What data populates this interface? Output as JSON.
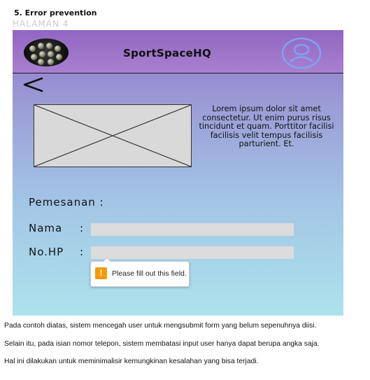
{
  "doc": {
    "section_heading": "5. Error prevention",
    "page_label": "HALAMAN 4",
    "paragraphs": [
      "Pada contoh diatas, sistem mencegah user untuk mengsubmit form yang belum sepenuhnya diisi.",
      "Selain itu, pada isian nomor telepon, sistem membatasi input user hanya dapat berupa angka saja.",
      "Hal ini dilakukan untuk meminimalisir kemungkinan kesalahan yang bisa terjadi."
    ]
  },
  "app": {
    "title": "SportSpaceHQ",
    "logo_icon": "sports-balls-logo",
    "profile_icon": "user-profile-icon",
    "back_icon": "back-arrow-icon",
    "description": "Lorem ipsum dolor sit amet consectetur. Ut enim purus risus tincidunt et quam. Porttitor facilisi facilisis velit tempus facilisis parturient. Et."
  },
  "form": {
    "section_label": "Pemesanan :",
    "name_label": "Nama",
    "name_value": "",
    "phone_label": "No.HP",
    "phone_value": "",
    "colon": ":",
    "validation_message": "Please fill out this field.",
    "warning_glyph": "!"
  },
  "colors": {
    "header_purple": "#9166c2",
    "gradient_bottom": "#ade3ec",
    "profile_icon": "#7fa3f2",
    "warning": "#f59a0c",
    "field_bg": "#dcdcdc"
  }
}
